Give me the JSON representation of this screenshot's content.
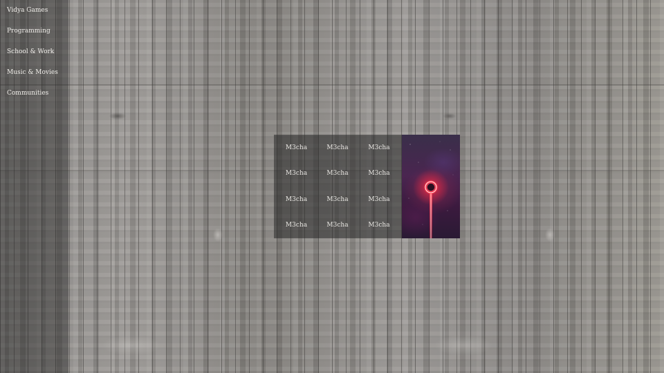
{
  "sidebar": {
    "items": [
      {
        "label": "Vidya Games"
      },
      {
        "label": "Programming"
      },
      {
        "label": "School & Work"
      },
      {
        "label": "Music & Movies"
      },
      {
        "label": "Communities"
      }
    ]
  },
  "grid": {
    "rows": [
      [
        "M3cha",
        "M3cha",
        "M3cha"
      ],
      [
        "M3cha",
        "M3cha",
        "M3cha"
      ],
      [
        "M3cha",
        "M3cha",
        "M3cha"
      ],
      [
        "M3cha",
        "M3cha",
        "M3cha"
      ]
    ]
  },
  "artwork": {
    "icon": "glowing-ring-artwork-icon",
    "accent_color": "#ff3b4e"
  }
}
